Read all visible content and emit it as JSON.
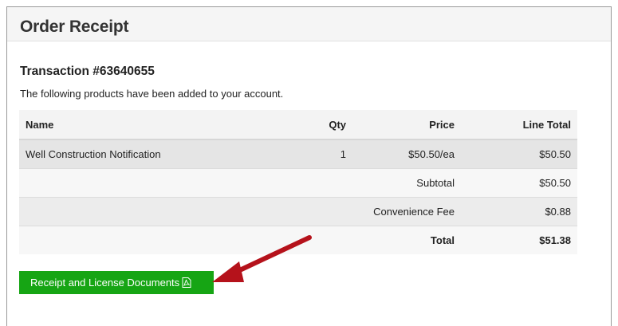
{
  "header": {
    "title": "Order Receipt"
  },
  "transaction": {
    "title": "Transaction #63640655",
    "description": "The following products have been added to your account."
  },
  "table": {
    "columns": {
      "name": "Name",
      "qty": "Qty",
      "price": "Price",
      "line_total": "Line Total"
    },
    "item": {
      "name": "Well Construction Notification",
      "qty": "1",
      "price": "$50.50/ea",
      "line_total": "$50.50"
    },
    "subtotal": {
      "label": "Subtotal",
      "value": "$50.50"
    },
    "fee": {
      "label": "Convenience Fee",
      "value": "$0.88"
    },
    "total": {
      "label": "Total",
      "value": "$51.38"
    }
  },
  "actions": {
    "documents_label": "Receipt and License Documents",
    "documents_icon": "pdf-file-icon"
  },
  "annotation": {
    "arrow_color": "#b5121b"
  },
  "colors": {
    "button_bg": "#16a514",
    "header_bg": "#f5f5f5"
  }
}
